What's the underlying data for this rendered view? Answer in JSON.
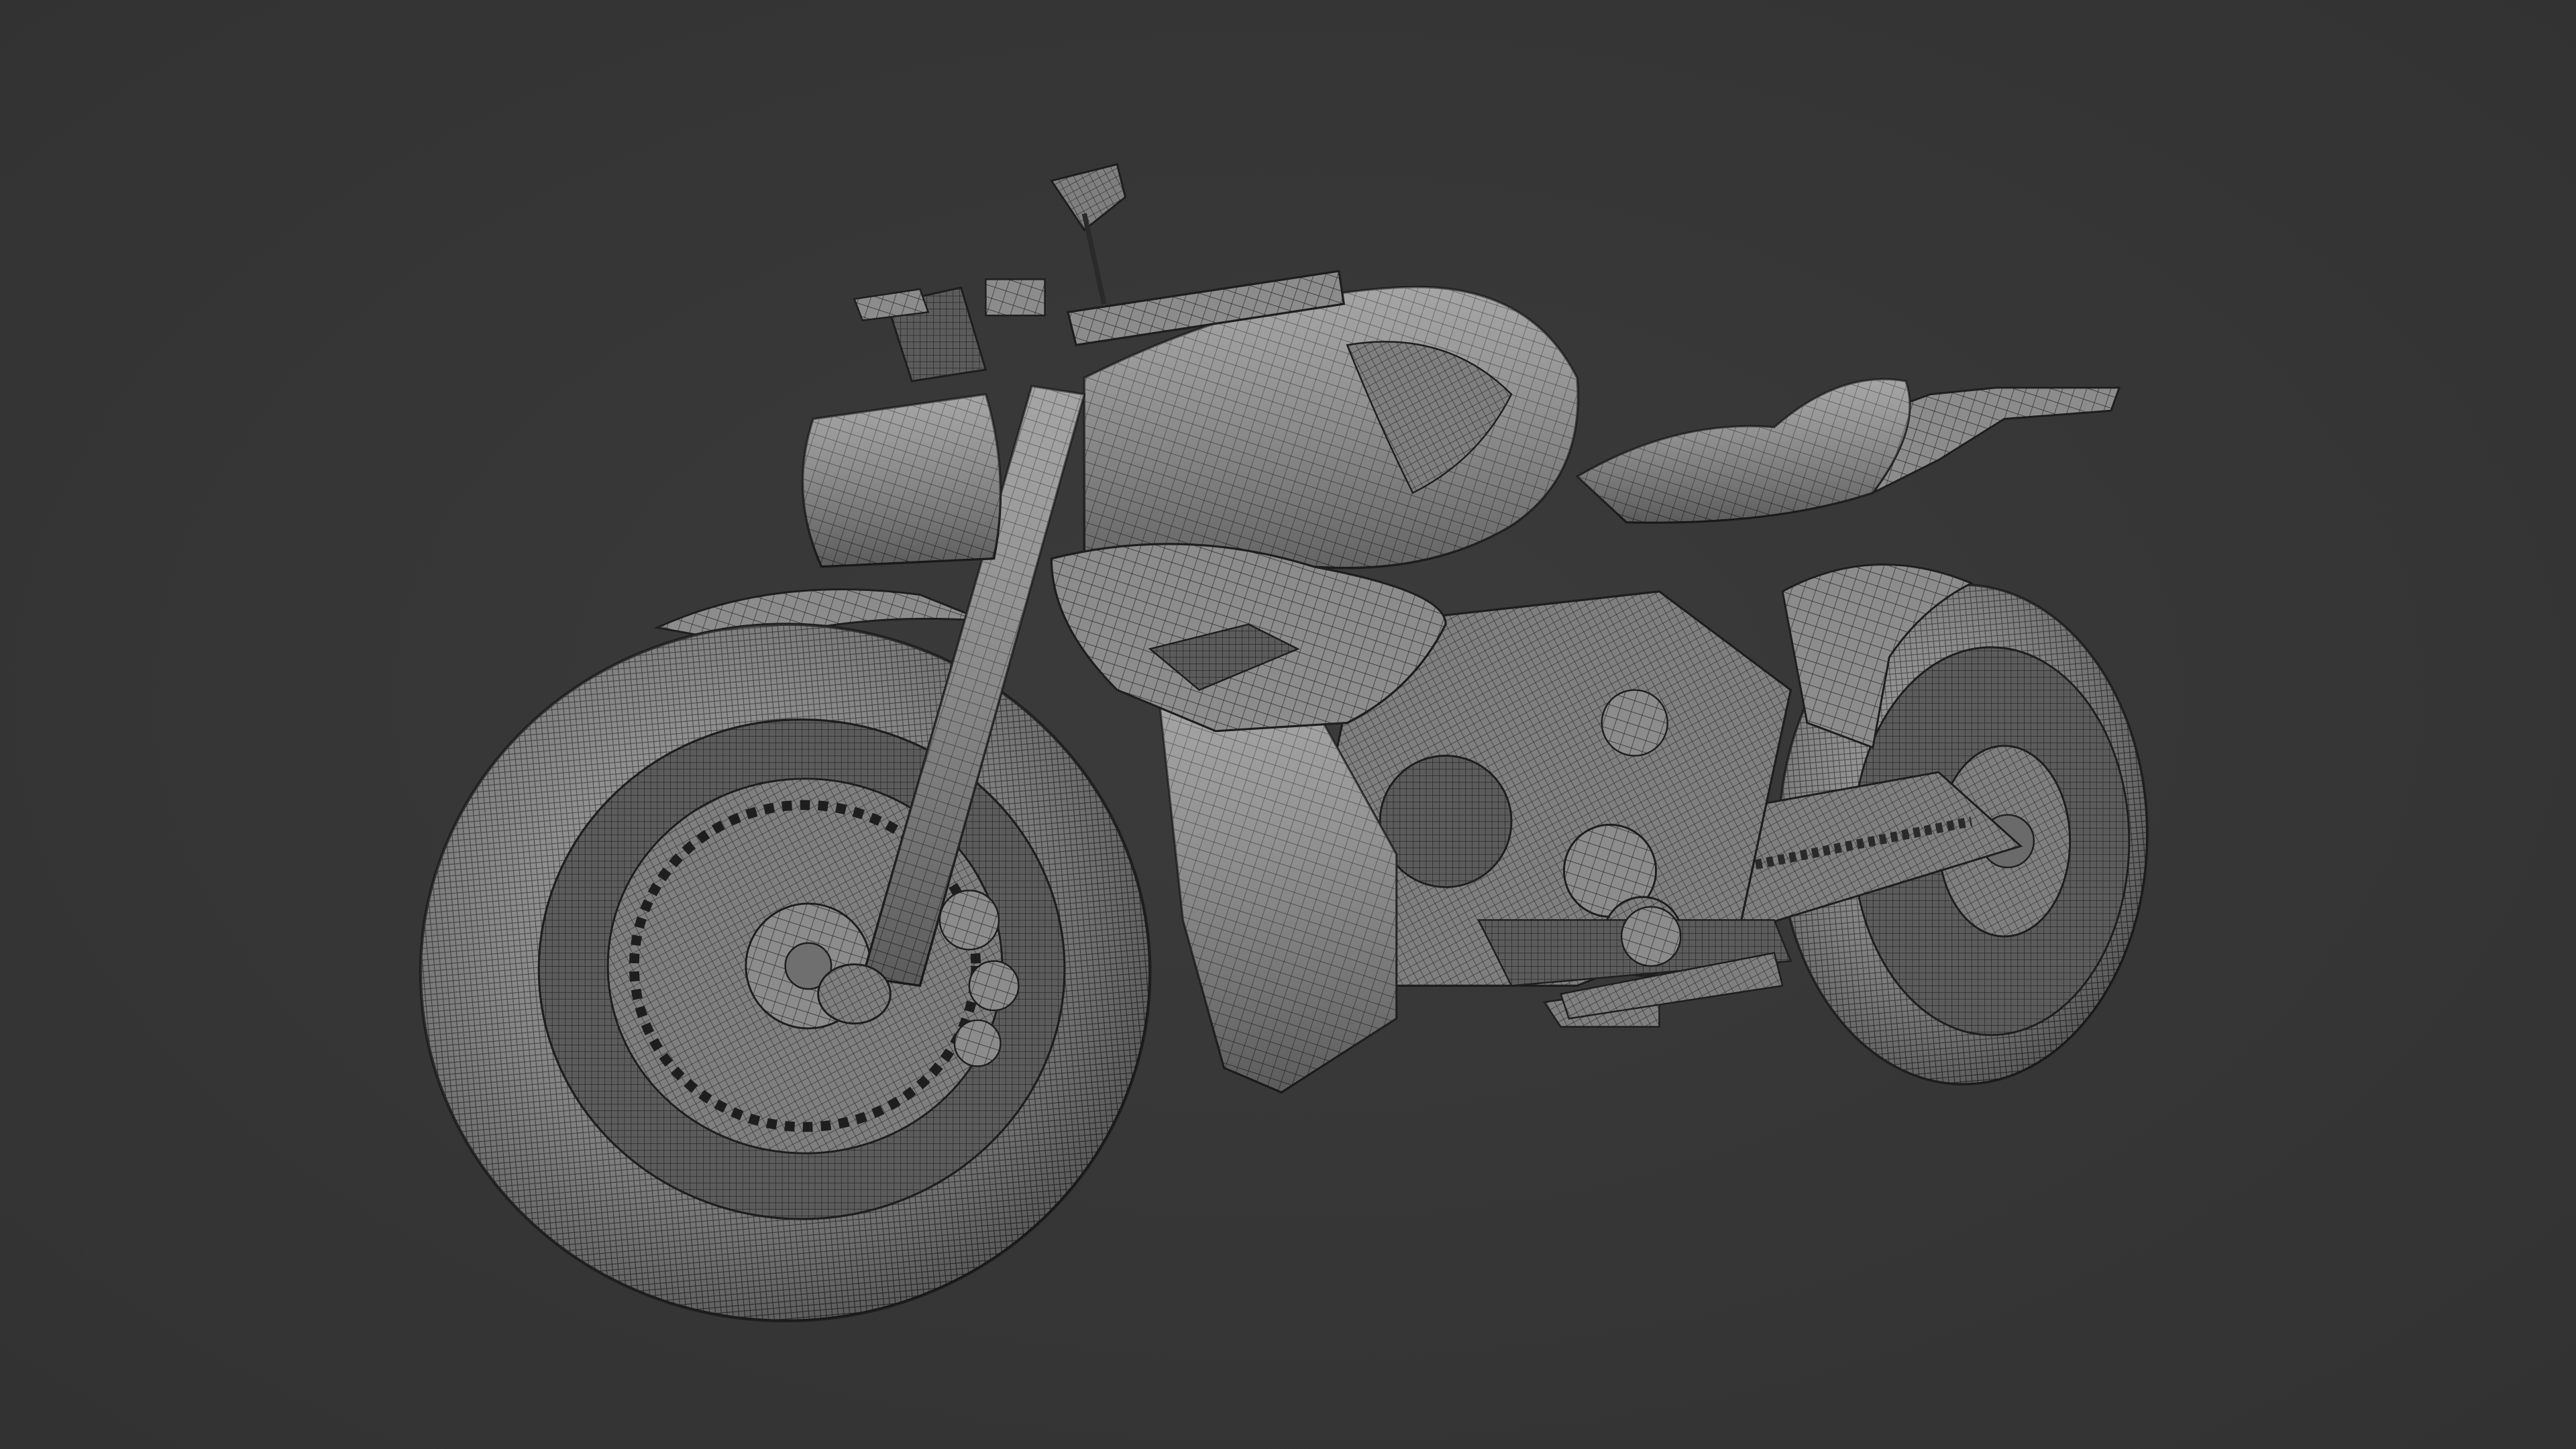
{
  "viewport": {
    "background_color": "#363636",
    "subject": "motorcycle-wireframe-model",
    "shading": "clay-grey",
    "wire_color": "#1e1e1e",
    "surface_color": "#8a8a8a"
  }
}
